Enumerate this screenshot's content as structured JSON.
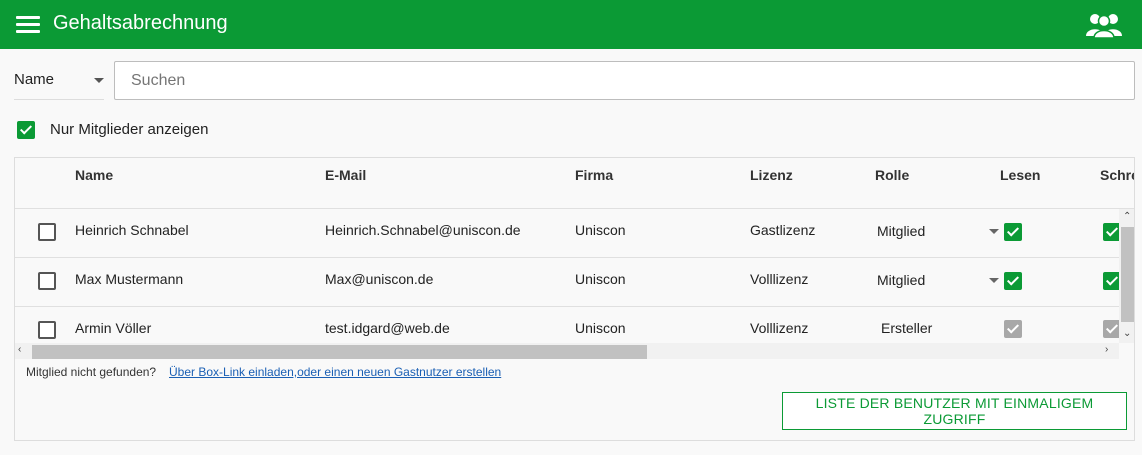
{
  "app": {
    "title": "Gehaltsabrechnung",
    "menu_icon": "hamburger-menu-icon",
    "users_icon": "users-group-icon",
    "brand_color": "#0b9a35"
  },
  "filter": {
    "field": "Name",
    "search_placeholder": "Suchen",
    "search_value": ""
  },
  "members_only": {
    "label": "Nur Mitglieder anzeigen",
    "checked": true
  },
  "table": {
    "columns": [
      "Name",
      "E-Mail",
      "Firma",
      "Lizenz",
      "Rolle",
      "Lesen",
      "Schre"
    ],
    "rows": [
      {
        "name": "Heinrich Schnabel",
        "email": "Heinrich.Schnabel@uniscon.de",
        "firma": "Uniscon",
        "lizenz": "Gastlizenz",
        "rolle": "Mitglied",
        "lesen": "checked",
        "schreiben": "checked",
        "selected": false
      },
      {
        "name": "Max Mustermann",
        "email": "Max@uniscon.de",
        "firma": "Uniscon",
        "lizenz": "Volllizenz",
        "rolle": "Mitglied",
        "lesen": "checked",
        "schreiben": "checked",
        "selected": false
      },
      {
        "name": "Armin Völler",
        "email": "test.idgard@web.de",
        "firma": "Uniscon",
        "lizenz": "Volllizenz",
        "rolle": "Ersteller",
        "lesen": "checked-disabled",
        "schreiben": "checked-disabled",
        "selected": false
      }
    ]
  },
  "footer": {
    "not_found_text": "Mitglied nicht gefunden?",
    "invite_link": "Über Box-Link einladen,oder einen neuen Gastnutzer erstellen",
    "onetime_button": "LISTE DER BENUTZER MIT EINMALIGEM ZUGRIFF"
  }
}
